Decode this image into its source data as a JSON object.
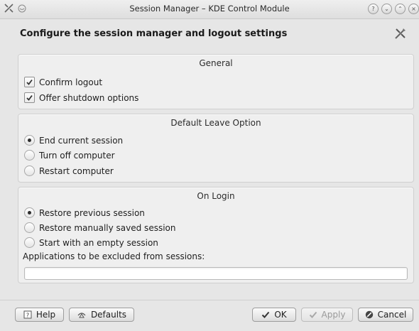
{
  "window": {
    "title": "Session Manager – KDE Control Module"
  },
  "header": {
    "title": "Configure the session manager and logout settings"
  },
  "general": {
    "title": "General",
    "confirm_logout": "Confirm logout",
    "confirm_logout_checked": true,
    "offer_shutdown": "Offer shutdown options",
    "offer_shutdown_checked": true
  },
  "leave": {
    "title": "Default Leave Option",
    "options": [
      {
        "label": "End current session",
        "selected": true
      },
      {
        "label": "Turn off computer",
        "selected": false
      },
      {
        "label": "Restart computer",
        "selected": false
      }
    ]
  },
  "login": {
    "title": "On Login",
    "options": [
      {
        "label": "Restore previous session",
        "selected": true
      },
      {
        "label": "Restore manually saved session",
        "selected": false
      },
      {
        "label": "Start with an empty session",
        "selected": false
      }
    ],
    "excluded_label": "Applications to be excluded from sessions:",
    "excluded_value": ""
  },
  "buttons": {
    "help": "Help",
    "defaults": "Defaults",
    "ok": "OK",
    "apply": "Apply",
    "cancel": "Cancel"
  }
}
